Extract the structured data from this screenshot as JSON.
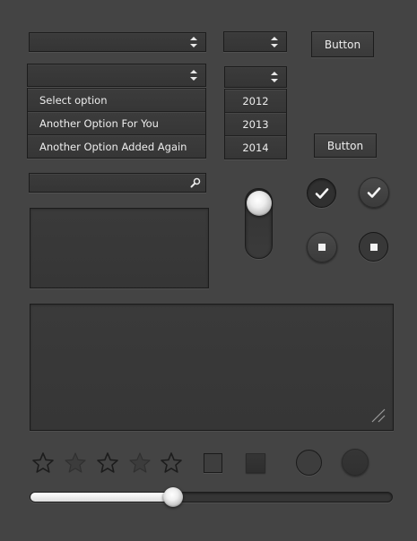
{
  "colors": {
    "background": "#444444",
    "text": "#e6e6e6",
    "border": "#1c1c1c"
  },
  "dropdowns": {
    "top_wide": {
      "value": "",
      "icon": "spinner-arrows-icon"
    },
    "top_small": {
      "value": "",
      "icon": "spinner-arrows-icon"
    }
  },
  "buttons": {
    "top_label": "Button",
    "mid_label": "Button"
  },
  "open_select": {
    "value": "",
    "options": [
      "Select option",
      "Another Option For You",
      "Another Option Added Again"
    ]
  },
  "year_select": {
    "value": "",
    "options": [
      "2012",
      "2013",
      "2014"
    ]
  },
  "search": {
    "value": "",
    "icon": "search-icon"
  },
  "textbox": {
    "value": ""
  },
  "textarea": {
    "value": "",
    "resize_icon": "resize-handle-icon"
  },
  "toggle": {
    "state": "on"
  },
  "checks": [
    {
      "checked": true,
      "style": "dark"
    },
    {
      "checked": true,
      "style": "light"
    }
  ],
  "stops": [
    {
      "style": "light"
    },
    {
      "style": "dark"
    }
  ],
  "rating": {
    "max": 5,
    "value": 0,
    "icon": "star-icon"
  },
  "checkboxes": [
    {
      "checked": false
    },
    {
      "checked": false
    }
  ],
  "radios": [
    {
      "checked": false
    },
    {
      "checked": false
    }
  ],
  "slider": {
    "value": 0.4
  }
}
